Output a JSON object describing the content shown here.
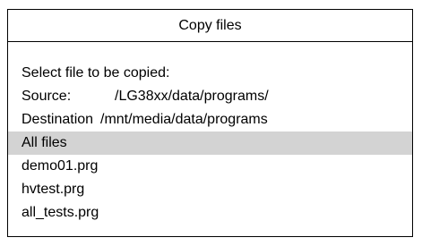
{
  "dialog": {
    "title": "Copy files",
    "prompt": "Select file to be copied:",
    "source": {
      "label": "Source:",
      "path": "/LG38xx/data/programs/"
    },
    "destination": {
      "label": "Destination",
      "path": "/mnt/media/data/programs"
    },
    "files": [
      {
        "name": "All files",
        "selected": true
      },
      {
        "name": "demo01.prg",
        "selected": false
      },
      {
        "name": "hvtest.prg",
        "selected": false
      },
      {
        "name": "all_tests.prg",
        "selected": false
      }
    ]
  },
  "colors": {
    "border": "#000000",
    "background": "#ffffff",
    "selection": "#d3d3d3"
  }
}
